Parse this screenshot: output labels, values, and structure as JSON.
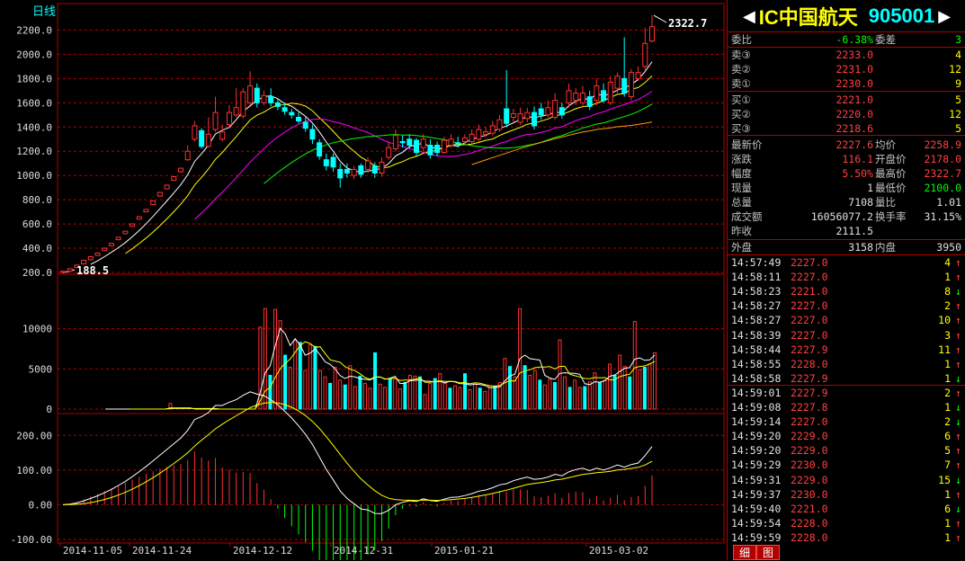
{
  "chart_data": [
    {
      "type": "candlestick",
      "title": "日线",
      "ylim": [
        200,
        2300
      ],
      "y_ticks": [
        "2200.0",
        "2000.0",
        "1800.0",
        "1600.0",
        "1400.0",
        "1200.0",
        "1000.0",
        "800.0",
        "600.0",
        "400.0",
        "200.0"
      ],
      "y_tick_values": [
        2200,
        2000,
        1800,
        1600,
        1400,
        1200,
        1000,
        800,
        600,
        400,
        200
      ],
      "annotations": {
        "high_label": "2322.7",
        "low_label": "188.5"
      },
      "open": [
        200,
        210,
        240,
        270,
        305,
        340,
        380,
        420,
        470,
        520,
        580,
        640,
        700,
        760,
        830,
        890,
        960,
        1030,
        1130,
        1300,
        1370,
        1240,
        1380,
        1300,
        1420,
        1500,
        1490,
        1600,
        1720,
        1600,
        1650,
        1600,
        1560,
        1520,
        1480,
        1440,
        1380,
        1270,
        1130,
        1150,
        1050,
        1050,
        1000,
        1080,
        1050,
        1080,
        1020,
        1150,
        1220,
        1280,
        1300,
        1290,
        1230,
        1250,
        1250,
        1190,
        1250,
        1270,
        1280,
        1280,
        1300,
        1340,
        1350,
        1380,
        1550,
        1480,
        1440,
        1470,
        1520,
        1550,
        1500,
        1480,
        1560,
        1600,
        1620,
        1600,
        1650,
        1620,
        1700,
        1600,
        1720,
        1800,
        1650,
        1800,
        1900,
        2110
      ],
      "close": [
        210,
        230,
        260,
        300,
        330,
        360,
        400,
        440,
        490,
        540,
        600,
        660,
        720,
        790,
        860,
        920,
        990,
        1060,
        1200,
        1410,
        1240,
        1340,
        1520,
        1360,
        1520,
        1560,
        1690,
        1740,
        1600,
        1660,
        1600,
        1570,
        1530,
        1500,
        1450,
        1390,
        1300,
        1160,
        1080,
        1070,
        980,
        1020,
        1050,
        1010,
        1120,
        1020,
        1110,
        1230,
        1330,
        1270,
        1250,
        1190,
        1300,
        1170,
        1190,
        1290,
        1300,
        1260,
        1310,
        1340,
        1380,
        1360,
        1410,
        1460,
        1430,
        1510,
        1510,
        1520,
        1410,
        1500,
        1560,
        1620,
        1500,
        1700,
        1680,
        1680,
        1570,
        1740,
        1620,
        1770,
        1820,
        1680,
        1850,
        1850,
        2090,
        2228
      ],
      "high": [
        215,
        235,
        265,
        305,
        335,
        365,
        405,
        445,
        495,
        545,
        605,
        665,
        725,
        795,
        865,
        925,
        995,
        1065,
        1250,
        1450,
        1390,
        1480,
        1650,
        1420,
        1580,
        1720,
        1720,
        1860,
        1760,
        1700,
        1720,
        1630,
        1600,
        1550,
        1520,
        1480,
        1420,
        1300,
        1180,
        1180,
        1100,
        1100,
        1080,
        1100,
        1150,
        1110,
        1150,
        1280,
        1380,
        1330,
        1340,
        1310,
        1340,
        1300,
        1280,
        1320,
        1340,
        1320,
        1340,
        1380,
        1420,
        1400,
        1450,
        1500,
        1870,
        1550,
        1560,
        1560,
        1570,
        1600,
        1620,
        1680,
        1600,
        1760,
        1720,
        1740,
        1700,
        1800,
        1760,
        1820,
        1850,
        2140,
        1880,
        1900,
        2220,
        2322
      ],
      "low": [
        195,
        205,
        235,
        265,
        300,
        335,
        375,
        415,
        465,
        515,
        575,
        635,
        695,
        755,
        825,
        885,
        955,
        1025,
        1120,
        1280,
        1220,
        1230,
        1360,
        1280,
        1400,
        1480,
        1470,
        1580,
        1560,
        1580,
        1570,
        1540,
        1500,
        1470,
        1430,
        1360,
        1260,
        1130,
        1040,
        1030,
        900,
        980,
        970,
        980,
        1020,
        980,
        990,
        1130,
        1200,
        1230,
        1220,
        1160,
        1200,
        1140,
        1160,
        1180,
        1230,
        1230,
        1250,
        1260,
        1280,
        1320,
        1330,
        1360,
        1400,
        1440,
        1420,
        1440,
        1380,
        1460,
        1480,
        1460,
        1470,
        1560,
        1580,
        1560,
        1540,
        1580,
        1600,
        1580,
        1680,
        1650,
        1620,
        1780,
        1860,
        2100
      ]
    },
    {
      "type": "bar",
      "title": "volume",
      "ylim": [
        0,
        16000
      ],
      "y_ticks": [
        "10000",
        "5000",
        "0"
      ],
      "y_tick_values": [
        10000,
        5000,
        0
      ],
      "values": [
        0,
        0,
        0,
        0,
        0,
        0,
        0,
        0,
        0,
        0,
        0,
        0,
        0,
        0,
        0,
        0,
        0,
        700,
        0,
        0,
        0,
        0,
        0,
        0,
        0,
        0,
        0,
        0,
        0,
        0,
        0,
        0,
        0,
        0,
        0,
        10200,
        12500,
        4200,
        12400,
        11000,
        6700,
        5200,
        8500,
        8300,
        4800,
        8000,
        7800,
        4800,
        4000,
        3200,
        5200,
        3600,
        3000,
        5400,
        2800,
        4100,
        3200,
        2600,
        7000,
        3100,
        2700,
        3800,
        3800,
        2500,
        3300,
        4200,
        4100,
        4000,
        1800,
        3200,
        3800,
        4400,
        3200,
        2600,
        2900,
        2700,
        4400,
        2400,
        3100,
        2600,
        2200,
        2900,
        2800,
        3300,
        6300,
        5300,
        4000,
        12500,
        5400,
        4200,
        4800,
        3600,
        3000,
        3700,
        3300,
        8600,
        4000,
        2700,
        3600,
        2700,
        2800,
        3400,
        4500,
        3300,
        3600,
        5600,
        4200,
        6700,
        5300,
        4000,
        10900,
        4900,
        5200,
        5600,
        7000
      ],
      "up_colors": {
        "up": "#ff3030",
        "down": "#00ffff"
      }
    },
    {
      "type": "bar",
      "title": "MACD",
      "ylim": [
        -100,
        250
      ],
      "y_ticks": [
        "200.00",
        "100.00",
        "0.00",
        "-100.00"
      ],
      "y_tick_values": [
        200,
        100,
        0,
        -100
      ],
      "x_labels": [
        "2014-11-05",
        "2014-11-24",
        "2014-12-12",
        "2014-12-31",
        "2015-01-21",
        "2015-03-02"
      ]
    }
  ],
  "chart_labels": {
    "period": "日线",
    "high_mark": "2322.7",
    "low_mark": "188.5"
  },
  "panel": {
    "name": "IC中国航天",
    "code": "905001",
    "ratio_label": "委比",
    "ratio_value": "-6.38%",
    "diff_label": "委差",
    "diff_value": "3",
    "sells": [
      {
        "label": "卖③",
        "price": "2233.0",
        "vol": "4"
      },
      {
        "label": "卖②",
        "price": "2231.0",
        "vol": "12"
      },
      {
        "label": "卖①",
        "price": "2230.0",
        "vol": "9"
      }
    ],
    "buys": [
      {
        "label": "买①",
        "price": "2221.0",
        "vol": "5"
      },
      {
        "label": "买②",
        "price": "2220.0",
        "vol": "12"
      },
      {
        "label": "买③",
        "price": "2218.6",
        "vol": "5"
      }
    ],
    "stats": [
      {
        "l1": "最新价",
        "v1": "2227.6",
        "c1": "red",
        "l2": "均价",
        "v2": "2258.9",
        "c2": "red"
      },
      {
        "l1": "涨跌",
        "v1": "116.1",
        "c1": "red",
        "l2": "开盘价",
        "v2": "2178.0",
        "c2": "red"
      },
      {
        "l1": "幅度",
        "v1": "5.50%",
        "c1": "red",
        "l2": "最高价",
        "v2": "2322.7",
        "c2": "red"
      },
      {
        "l1": "现量",
        "v1": "1",
        "c1": "white",
        "l2": "最低价",
        "v2": "2100.0",
        "c2": "green"
      },
      {
        "l1": "总量",
        "v1": "7108",
        "c1": "white",
        "l2": "量比",
        "v2": "1.01",
        "c2": "white"
      },
      {
        "l1": "成交额",
        "v1": "16056077.2",
        "c1": "white",
        "l2": "换手率",
        "v2": "31.15%",
        "c2": "white"
      },
      {
        "l1": "昨收",
        "v1": "2111.5",
        "c1": "white",
        "l2": "",
        "v2": "",
        "c2": "white"
      }
    ],
    "outer_label": "外盘",
    "outer_value": "3158",
    "inner_label": "内盘",
    "inner_value": "3950",
    "ticks": [
      {
        "time": "14:57:49",
        "price": "2227.0",
        "vol": "4",
        "dir": "up"
      },
      {
        "time": "14:58:11",
        "price": "2227.0",
        "vol": "1",
        "dir": "up"
      },
      {
        "time": "14:58:23",
        "price": "2221.0",
        "vol": "8",
        "dir": "down"
      },
      {
        "time": "14:58:27",
        "price": "2227.0",
        "vol": "2",
        "dir": "up"
      },
      {
        "time": "14:58:27",
        "price": "2227.0",
        "vol": "10",
        "dir": "up"
      },
      {
        "time": "14:58:39",
        "price": "2227.0",
        "vol": "3",
        "dir": "up"
      },
      {
        "time": "14:58:44",
        "price": "2227.9",
        "vol": "11",
        "dir": "up"
      },
      {
        "time": "14:58:55",
        "price": "2228.0",
        "vol": "1",
        "dir": "up"
      },
      {
        "time": "14:58:58",
        "price": "2227.9",
        "vol": "1",
        "dir": "down"
      },
      {
        "time": "14:59:01",
        "price": "2227.9",
        "vol": "2",
        "dir": "up"
      },
      {
        "time": "14:59:08",
        "price": "2227.8",
        "vol": "1",
        "dir": "down"
      },
      {
        "time": "14:59:14",
        "price": "2227.0",
        "vol": "2",
        "dir": "down"
      },
      {
        "time": "14:59:20",
        "price": "2229.0",
        "vol": "6",
        "dir": "up"
      },
      {
        "time": "14:59:20",
        "price": "2229.0",
        "vol": "5",
        "dir": "up"
      },
      {
        "time": "14:59:29",
        "price": "2230.0",
        "vol": "7",
        "dir": "up"
      },
      {
        "time": "14:59:31",
        "price": "2229.0",
        "vol": "15",
        "dir": "down"
      },
      {
        "time": "14:59:37",
        "price": "2230.0",
        "vol": "1",
        "dir": "up"
      },
      {
        "time": "14:59:40",
        "price": "2221.0",
        "vol": "6",
        "dir": "down"
      },
      {
        "time": "14:59:54",
        "price": "2228.0",
        "vol": "1",
        "dir": "up"
      },
      {
        "time": "14:59:59",
        "price": "2228.0",
        "vol": "1",
        "dir": "up"
      }
    ],
    "tabs": [
      "细",
      "图"
    ]
  },
  "colors": {
    "up": "#ff3030",
    "down": "#00ffff",
    "grid": "#b00000",
    "ma5": "#ffffff",
    "ma10": "#ffff00",
    "ma20": "#ff00ff",
    "ma60": "#00ff00",
    "ma120": "#ff9900"
  }
}
